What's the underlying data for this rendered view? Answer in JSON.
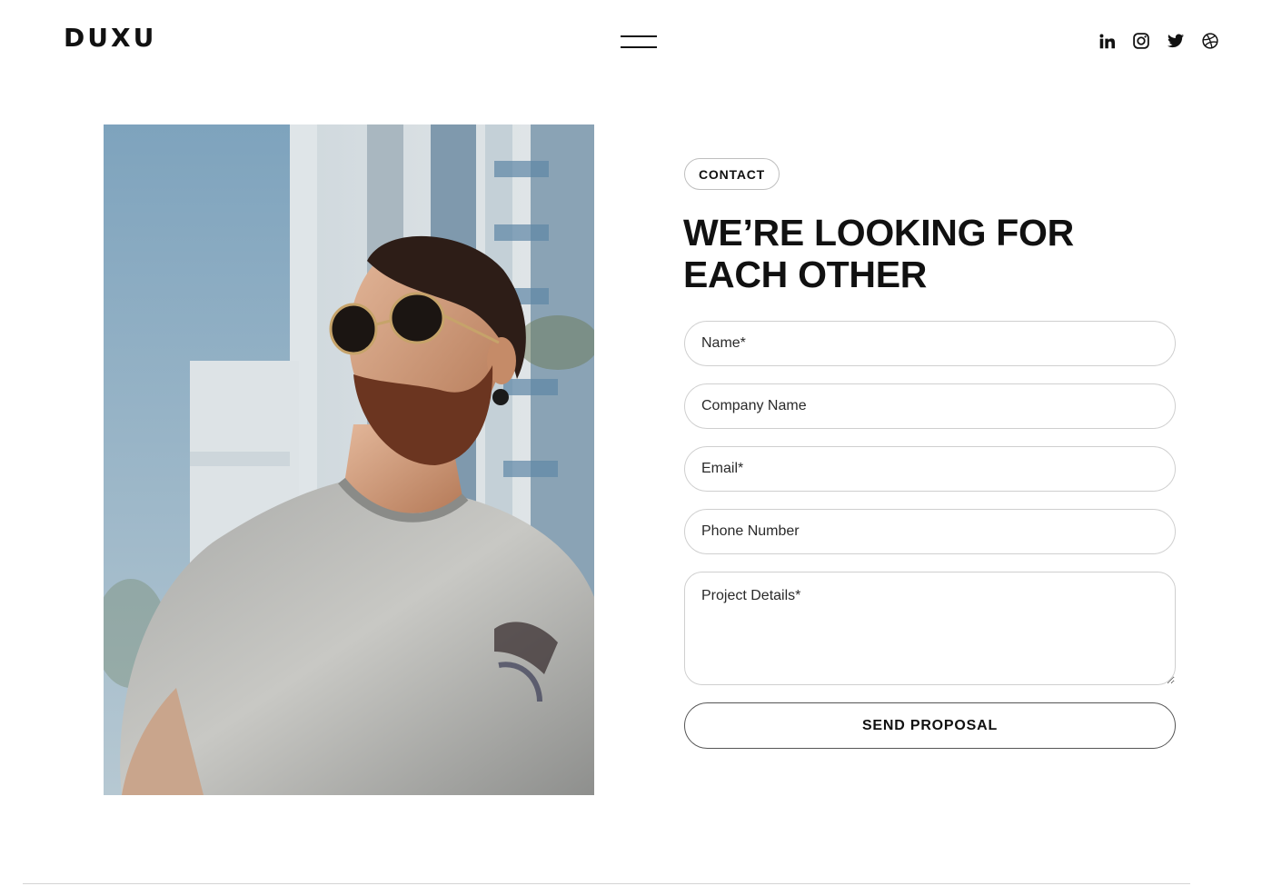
{
  "header": {
    "logo": "DUXU",
    "menu_icon": "hamburger-menu-icon",
    "social": [
      {
        "name": "linkedin-icon"
      },
      {
        "name": "instagram-icon"
      },
      {
        "name": "twitter-icon"
      },
      {
        "name": "dribbble-icon"
      }
    ]
  },
  "contact": {
    "tag": "CONTACT",
    "heading_line1": "WE’RE LOOKING FOR",
    "heading_line2": "EACH OTHER",
    "fields": {
      "name_placeholder": "Name*",
      "company_placeholder": "Company Name",
      "email_placeholder": "Email*",
      "phone_placeholder": "Phone Number",
      "details_placeholder": "Project Details*"
    },
    "submit_label": "SEND PROPOSAL"
  },
  "colors": {
    "text": "#111111",
    "border": "#cfcfcf",
    "background": "#ffffff"
  }
}
